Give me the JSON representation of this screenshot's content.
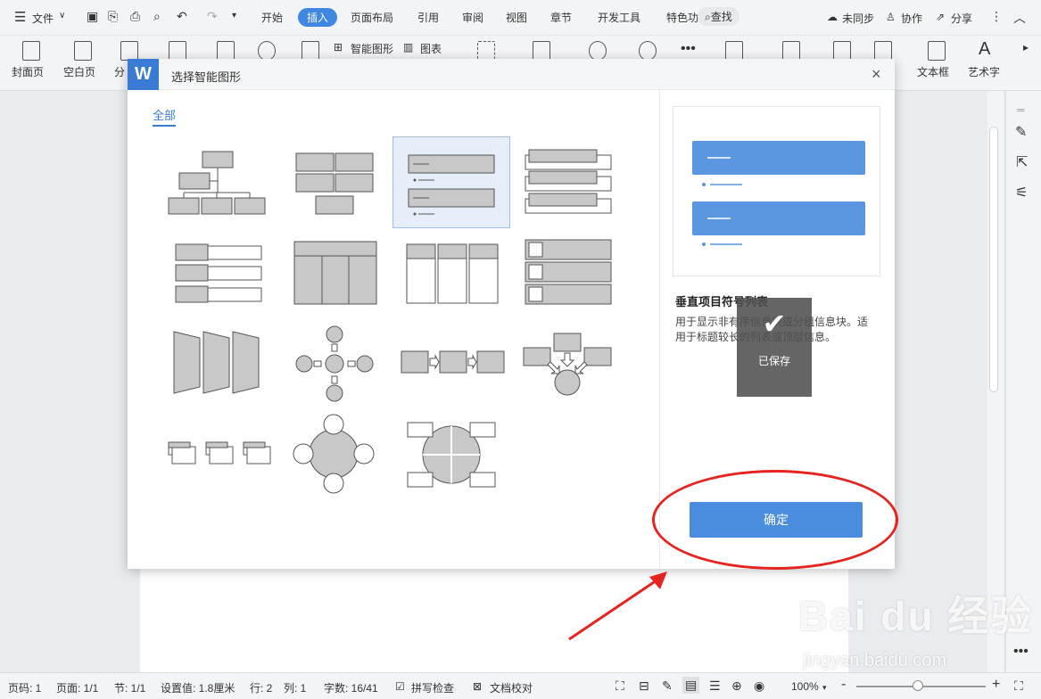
{
  "topbar": {
    "file_label": "文件",
    "tabs": [
      "开始",
      "插入",
      "页面布局",
      "引用",
      "审阅",
      "视图",
      "章节",
      "开发工具",
      "特色功能"
    ],
    "active_tab": "插入",
    "search_label": "查找",
    "sync_label": "未同步",
    "collab_label": "协作",
    "share_label": "分享"
  },
  "ribbon": {
    "cover_label": "封面页",
    "blank_label": "空白页",
    "page_break_label": "分",
    "smartart_label": "智能图形",
    "chart_label": "图表",
    "textbox_label": "文本框",
    "wordart_label": "艺术字"
  },
  "dialog": {
    "title": "选择智能图形",
    "close_glyph": "×",
    "filter_tab": "全部",
    "selected_name": "垂直项目符号列表",
    "selected_desc": "用于显示非有序信息块或分组信息块。适用于标题较长的列表或顶层信息。",
    "toast_label": "已保存",
    "confirm_label": "确定"
  },
  "statusbar": {
    "page_code": "页码: 1",
    "pages": "页面: 1/1",
    "section": "节: 1/1",
    "setting": "设置值: 1.8厘米",
    "row": "行: 2",
    "col": "列: 1",
    "wordcount": "字数: 16/41",
    "spellcheck": "拼写检查",
    "proofread": "文档校对",
    "zoom": "100%",
    "zoom_minus": "-",
    "zoom_plus": "+"
  },
  "watermark": {
    "logo_text": "Bai du 经验",
    "url_text": "jingyan.baidu.com"
  },
  "colors": {
    "accent": "#3a7bd5",
    "button": "#4a8ddf",
    "annotation": "#e5231f"
  }
}
